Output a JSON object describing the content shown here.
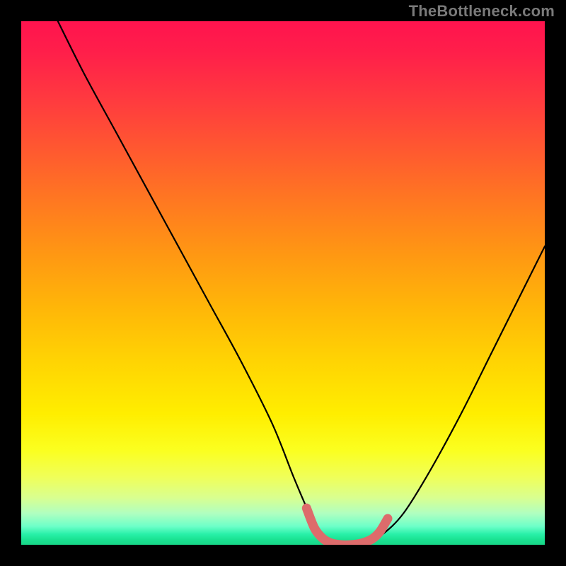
{
  "watermark": "TheBottleneck.com",
  "chart_data": {
    "type": "line",
    "title": "",
    "xlabel": "",
    "ylabel": "",
    "xlim": [
      0,
      100
    ],
    "ylim": [
      0,
      100
    ],
    "grid": false,
    "legend": false,
    "series": [
      {
        "name": "bottleneck-curve",
        "color": "#000000",
        "x": [
          7,
          12,
          18,
          24,
          30,
          36,
          42,
          48,
          52,
          55,
          57,
          60,
          63,
          66,
          69,
          73,
          78,
          84,
          90,
          96,
          100
        ],
        "y": [
          100,
          90,
          79,
          68,
          57,
          46,
          35,
          23,
          13,
          6,
          2,
          0,
          0,
          0.5,
          2,
          6,
          14,
          25,
          37,
          49,
          57
        ]
      },
      {
        "name": "optimal-range-highlight",
        "color": "#dd6b6b",
        "x": [
          54.5,
          56,
          57.5,
          59,
          61,
          63,
          65,
          67,
          68.5,
          70
        ],
        "y": [
          7,
          3.2,
          1.3,
          0.4,
          0,
          0,
          0.3,
          1.1,
          2.5,
          5
        ]
      }
    ],
    "annotations": [],
    "background": {
      "type": "vertical-gradient",
      "stops": [
        {
          "pos": 0,
          "color": "#ff134e"
        },
        {
          "pos": 50,
          "color": "#ffb000"
        },
        {
          "pos": 80,
          "color": "#ffff00"
        },
        {
          "pos": 100,
          "color": "#18d688"
        }
      ]
    }
  }
}
